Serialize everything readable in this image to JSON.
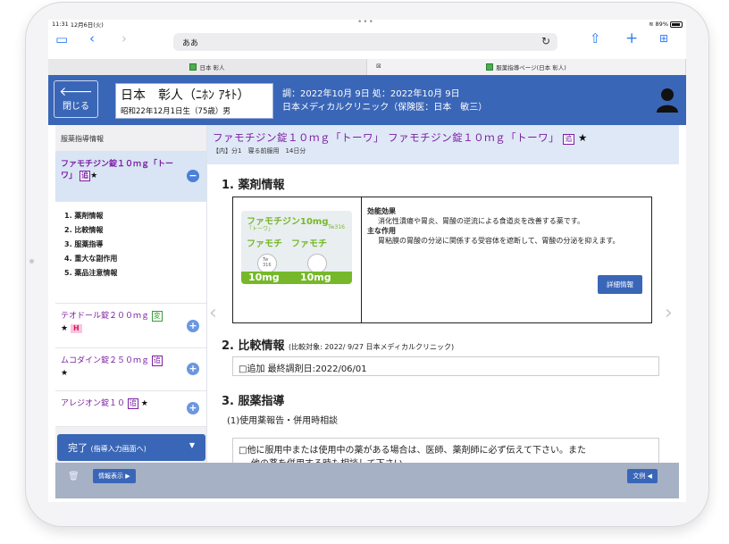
{
  "status": {
    "time": "11:31",
    "date": "12月6日(火)",
    "battery": "89%"
  },
  "browser": {
    "address": "ああ"
  },
  "tabs": [
    {
      "label": "日本 彰人"
    },
    {
      "label": "服薬指導ページ(日本 彰人)"
    }
  ],
  "header": {
    "back_label": "閉じる",
    "patient_name": "日本　彰人（ﾆﾎﾝ ｱｷﾄ）",
    "patient_birth": "昭和22年12月1日生（75歳）男",
    "rx_line1": "調：2022年10月 9日 処：2022年10月 9日",
    "rx_line2": "日本メディカルクリニック（保険医：日本　敏三）"
  },
  "sidebar": {
    "title": "服薬指導情報",
    "active_drug": {
      "name": "ファモチジン錠１０ｍｇ「トーワ」",
      "tag": "追",
      "star": "★"
    },
    "menu": [
      "1. 薬剤情報",
      "2. 比較情報",
      "3. 服薬指導",
      "4. 重大な副作用",
      "5. 薬品注意情報"
    ],
    "drugs": [
      {
        "name": "テオドール錠２００ｍｇ",
        "tag": "変",
        "star": "★",
        "extra": "H"
      },
      {
        "name": "ムコダイン錠２５０ｍｇ",
        "tag": "追",
        "star": "★"
      },
      {
        "name": "アレジオン錠１０",
        "tag": "追",
        "star": "★"
      }
    ],
    "done_label": "完了",
    "done_sub": "(指導入力画面へ)"
  },
  "main": {
    "drug_title": "ファモチジン錠１０ｍｇ「トーワ」 ファモチジン錠１０ｍｇ「トーワ」",
    "drug_tag": "追",
    "drug_star": "★",
    "drug_sub": "【内】分1　寝る前服用　14日分",
    "sec1": "1. 薬剤情報",
    "image": {
      "brand": "ファモチジン10mg",
      "brand_sub": "「トーワ」",
      "code": "Tw316",
      "brand2": "ファモチ　ファモチ",
      "pill_text": "Tw\n316",
      "mg": "10mg"
    },
    "effect_heading": "効能効果",
    "effect_text": "消化性潰瘍や胃炎、胃酸の逆流による食道炎を改善する薬です。",
    "action_heading": "主な作用",
    "action_text": "胃粘膜の胃酸の分泌に関係する受容体を遮断して、胃酸の分泌を抑えます。",
    "detail_button": "詳細情報",
    "sec2": "2. 比較情報",
    "sec2_note": "(比較対象: 2022/ 9/27 日本メディカルクリニック)",
    "sec2_row": "□追加 最終調剤日:2022/06/01",
    "sec3": "3. 服薬指導",
    "sec3_sub": "(1)使用薬報告・併用時相談",
    "sec3_row": "□他に服用中または使用中の薬がある場合は、医師、薬剤師に必ず伝えて下さい。また",
    "sec3_row2": "他の薬を併用する時も相談して下さい。"
  },
  "footer": {
    "info_button": "情報表示 ▶",
    "bunrei_button": "文例 ◀"
  }
}
